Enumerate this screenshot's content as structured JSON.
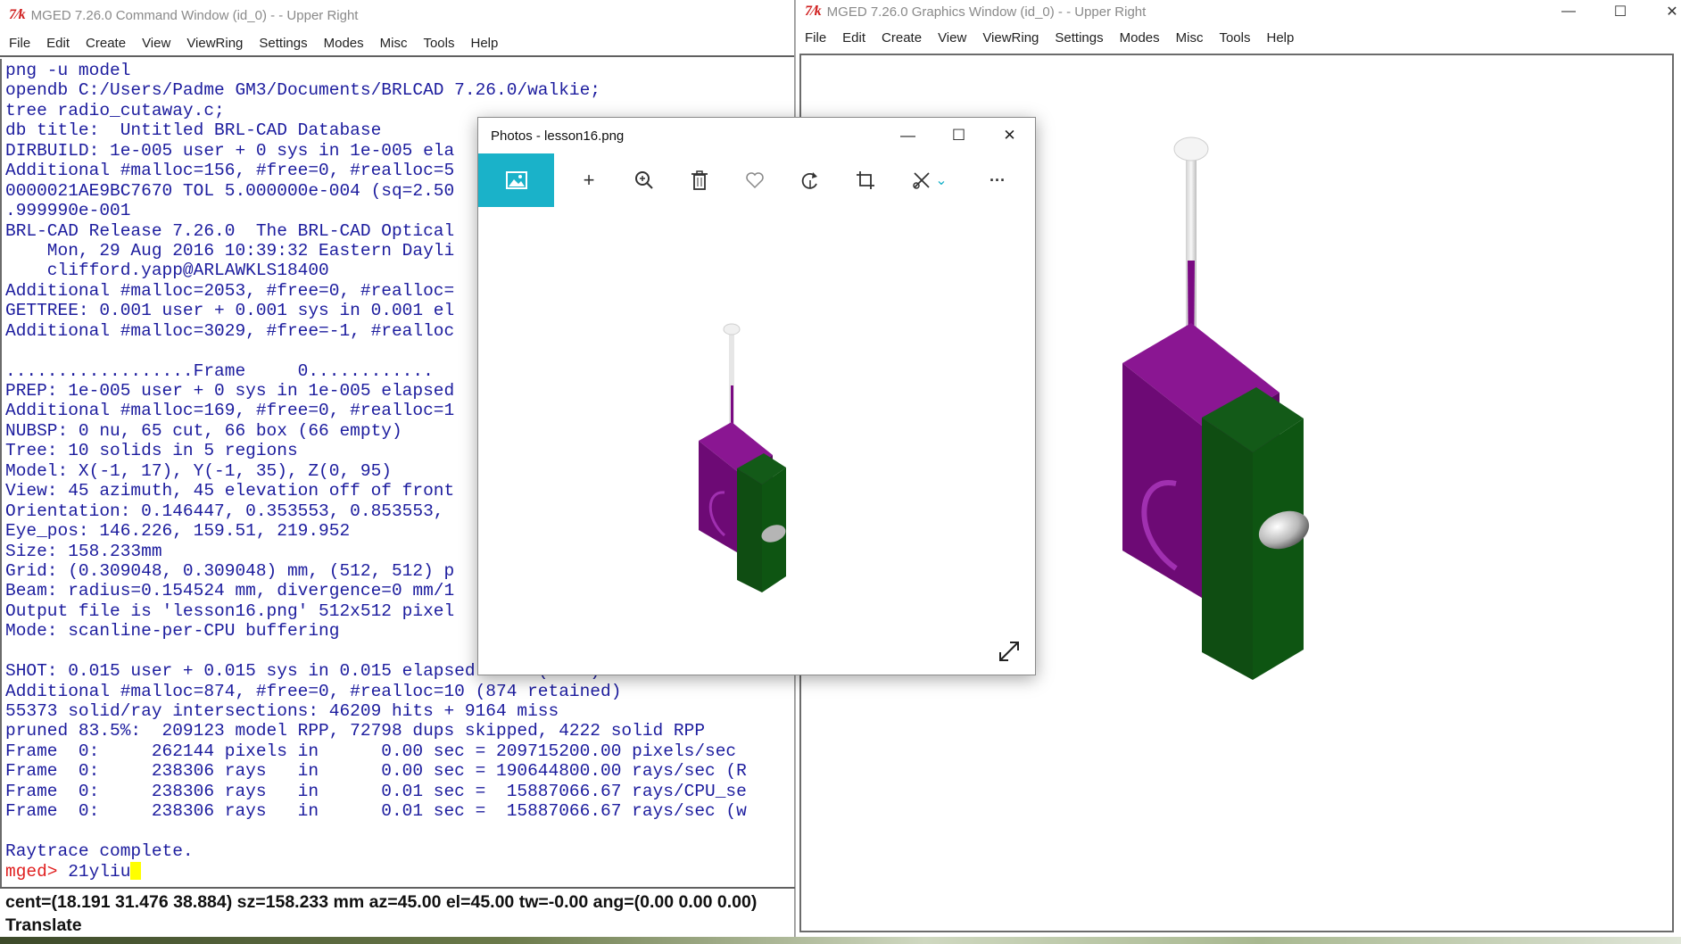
{
  "command_window": {
    "title": "MGED 7.26.0 Command Window (id_0) -  - Upper Right",
    "menu": [
      "File",
      "Edit",
      "Create",
      "View",
      "ViewRing",
      "Settings",
      "Modes",
      "Misc",
      "Tools",
      "Help"
    ],
    "console_lines": [
      "png -u model",
      "opendb C:/Users/Padme GM3/Documents/BRLCAD 7.26.0/walkie;",
      "tree radio_cutaway.c;",
      "db title:  Untitled BRL-CAD Database",
      "DIRBUILD: 1e-005 user + 0 sys in 1e-005 ela",
      "Additional #malloc=156, #free=0, #realloc=5",
      "0000021AE9BC7670 TOL 5.000000e-004 (sq=2.50",
      ".999990e-001",
      "BRL-CAD Release 7.26.0  The BRL-CAD Optical",
      "    Mon, 29 Aug 2016 10:39:32 Eastern Dayli",
      "    clifford.yapp@ARLAWKLS18400",
      "Additional #malloc=2053, #free=0, #realloc=",
      "GETTREE: 0.001 user + 0.001 sys in 0.001 el",
      "Additional #malloc=3029, #free=-1, #realloc",
      "",
      "..................Frame     0............",
      "PREP: 1e-005 user + 0 sys in 1e-005 elapsed",
      "Additional #malloc=169, #free=0, #realloc=1",
      "NUBSP: 0 nu, 65 cut, 66 box (66 empty)",
      "Tree: 10 solids in 5 regions",
      "Model: X(-1, 17), Y(-1, 35), Z(0, 95)",
      "View: 45 azimuth, 45 elevation off of front",
      "Orientation: 0.146447, 0.353553, 0.853553,",
      "Eye_pos: 146.226, 159.51, 219.952",
      "Size: 158.233mm",
      "Grid: (0.309048, 0.309048) mm, (512, 512) p",
      "Beam: radius=0.154524 mm, divergence=0 mm/1",
      "Output file is 'lesson16.png' 512x512 pixel",
      "Mode: scanline-per-CPU buffering",
      "",
      "SHOT: 0.015 user + 0.015 sys in 0.015 elapsed secs (1000)",
      "Additional #malloc=874, #free=0, #realloc=10 (874 retained)",
      "55373 solid/ray intersections: 46209 hits + 9164 miss",
      "pruned 83.5%:  209123 model RPP, 72798 dups skipped, 4222 solid RPP",
      "Frame  0:     262144 pixels in      0.00 sec = 209715200.00 pixels/sec",
      "Frame  0:     238306 rays   in      0.00 sec = 190644800.00 rays/sec (R",
      "Frame  0:     238306 rays   in      0.01 sec =  15887066.67 rays/CPU_se",
      "Frame  0:     238306 rays   in      0.01 sec =  15887066.67 rays/sec (w",
      "",
      "Raytrace complete."
    ],
    "prompt": "mged> ",
    "input_value": "21yliu",
    "status_line": "cent=(18.191 31.476 38.884) sz=158.233  mm  az=45.00  el=45.00  tw=-0.00  ang=(0.00 0.00 0.00)",
    "mode_line": "Translate"
  },
  "graphics_window": {
    "title": "MGED 7.26.0 Graphics Window (id_0) -  - Upper Right",
    "menu": [
      "File",
      "Edit",
      "Create",
      "View",
      "ViewRing",
      "Settings",
      "Modes",
      "Misc",
      "Tools",
      "Help"
    ],
    "controls": {
      "minimize": "—",
      "maximize": "☐",
      "close": "✕"
    }
  },
  "photos_window": {
    "title": "Photos - lesson16.png",
    "controls": {
      "minimize": "—",
      "maximize": "☐",
      "close": "✕"
    },
    "toolbar_icons": [
      "image-icon",
      "add-icon",
      "zoom-icon",
      "delete-icon",
      "favorite-icon",
      "rotate-icon",
      "crop-icon",
      "edit-icon",
      "more-icon"
    ],
    "toolbar_glyphs": {
      "add": "+",
      "more": "···",
      "chevron": "⌄"
    }
  },
  "colors": {
    "console_text": "#1c1c9e",
    "prompt": "#e02020",
    "cursor": "#ffff00",
    "model_body": "#7a0a82",
    "model_door": "#0f5a12",
    "photos_accent": "#1ab2c9"
  }
}
